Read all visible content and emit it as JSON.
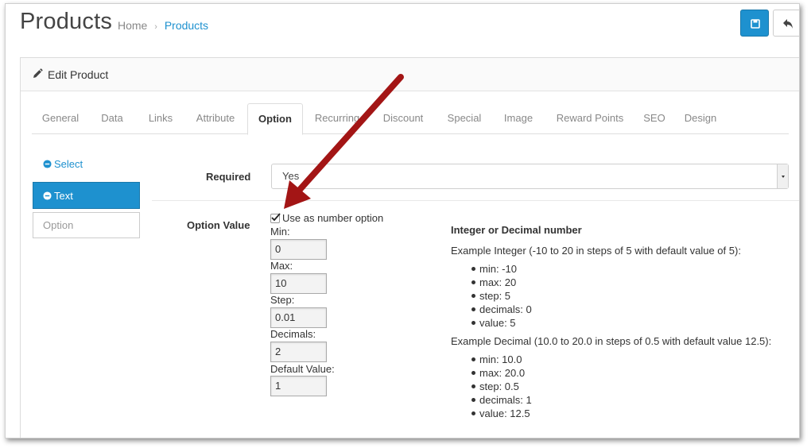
{
  "header": {
    "title": "Products",
    "breadcrumb": {
      "home": "Home",
      "separator": "›",
      "current": "Products"
    }
  },
  "buttons": {
    "save_icon": "save-icon",
    "back_icon": "reply-icon"
  },
  "panel": {
    "title": "Edit Product",
    "title_icon": "pencil-icon"
  },
  "tabs": [
    {
      "label": "General"
    },
    {
      "label": "Data"
    },
    {
      "label": "Links"
    },
    {
      "label": "Attribute"
    },
    {
      "label": "Option"
    },
    {
      "label": "Recurring"
    },
    {
      "label": "Discount"
    },
    {
      "label": "Special"
    },
    {
      "label": "Image"
    },
    {
      "label": "Reward Points"
    },
    {
      "label": "SEO"
    },
    {
      "label": "Design"
    }
  ],
  "active_tab": "Option",
  "sidebar": {
    "select": "Select",
    "text": "Text",
    "option_placeholder": "Option"
  },
  "form": {
    "required_label": "Required",
    "required_value": "Yes",
    "option_value_label": "Option Value",
    "use_number_option": "Use as number option",
    "use_number_checked": true,
    "min_label": "Min:",
    "min_value": "0",
    "max_label": "Max:",
    "max_value": "10",
    "step_label": "Step:",
    "step_value": "0.01",
    "decimals_label": "Decimals:",
    "decimals_value": "2",
    "default_label": "Default Value:",
    "default_value": "1"
  },
  "help": {
    "heading": "Integer or Decimal number",
    "integer_intro": "Example Integer (-10 to 20 in steps of 5 with default value of 5):",
    "integer_items": [
      "min: -10",
      "max: 20",
      "step: 5",
      "decimals: 0",
      "value: 5"
    ],
    "decimal_intro": "Example Decimal (10.0 to 20.0 in steps of 0.5 with default value 12.5):",
    "decimal_items": [
      "min: 10.0",
      "max: 20.0",
      "step: 0.5",
      "decimals: 1",
      "value: 12.5"
    ]
  },
  "colors": {
    "primary": "#1e91cf",
    "arrow": "#a31515"
  }
}
